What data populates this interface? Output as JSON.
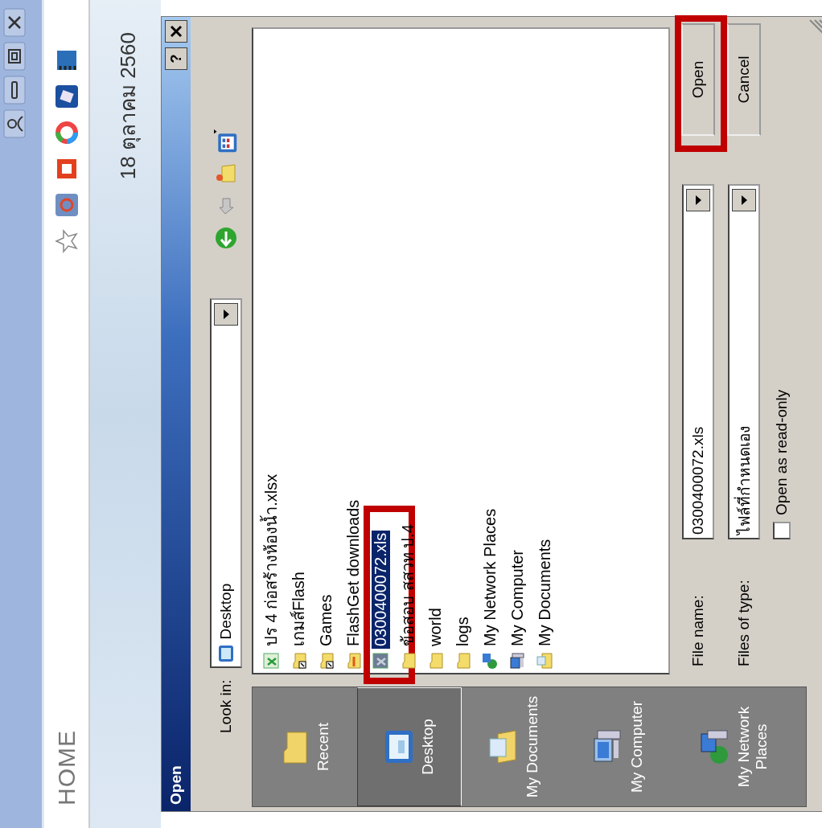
{
  "browser": {
    "address_text": "HOME",
    "date": "18 ตุลาคม 2560"
  },
  "dialog": {
    "title": "Open",
    "help_button": "?",
    "look_in": {
      "label": "Look in:",
      "value": "Desktop"
    },
    "places": [
      {
        "label": "Recent",
        "kind": "recent",
        "selected": false
      },
      {
        "label": "Desktop",
        "kind": "desktop",
        "selected": true
      },
      {
        "label": "My Documents",
        "kind": "documents",
        "selected": false
      },
      {
        "label": "My Computer",
        "kind": "computer",
        "selected": false
      },
      {
        "label": "My Network Places",
        "kind": "network",
        "selected": false
      }
    ],
    "files": [
      {
        "name": "ปร 4 ก่อสร้างห้องน้ำ.xlsx",
        "kind": "excel",
        "selected": false,
        "highlighted": false
      },
      {
        "name": "เกมส์Flash",
        "kind": "shortcut",
        "selected": false,
        "highlighted": false
      },
      {
        "name": "Games",
        "kind": "shortcut",
        "selected": false,
        "highlighted": false
      },
      {
        "name": "FlashGet downloads",
        "kind": "flashget",
        "selected": false,
        "highlighted": false
      },
      {
        "name": "0300400072.xls",
        "kind": "excel-gray",
        "selected": true,
        "highlighted": true
      },
      {
        "name": "ข้อสอบ สสวท ป.4",
        "kind": "folder",
        "selected": false,
        "highlighted": false
      },
      {
        "name": "world",
        "kind": "folder",
        "selected": false,
        "highlighted": false
      },
      {
        "name": "logs",
        "kind": "folder",
        "selected": false,
        "highlighted": false
      },
      {
        "name": "My Network Places",
        "kind": "network",
        "selected": false,
        "highlighted": false
      },
      {
        "name": "My Computer",
        "kind": "computer",
        "selected": false,
        "highlighted": false
      },
      {
        "name": "My Documents",
        "kind": "documents",
        "selected": false,
        "highlighted": false
      }
    ],
    "file_name": {
      "label": "File name:",
      "value": "0300400072.xls"
    },
    "file_type": {
      "label": "Files of type:",
      "value": "ไฟล์ที่กำหนดเอง"
    },
    "read_only": {
      "label": "Open as read-only",
      "checked": false
    },
    "buttons": [
      {
        "label": "Open",
        "highlighted": true
      },
      {
        "label": "Cancel",
        "highlighted": false
      }
    ]
  }
}
